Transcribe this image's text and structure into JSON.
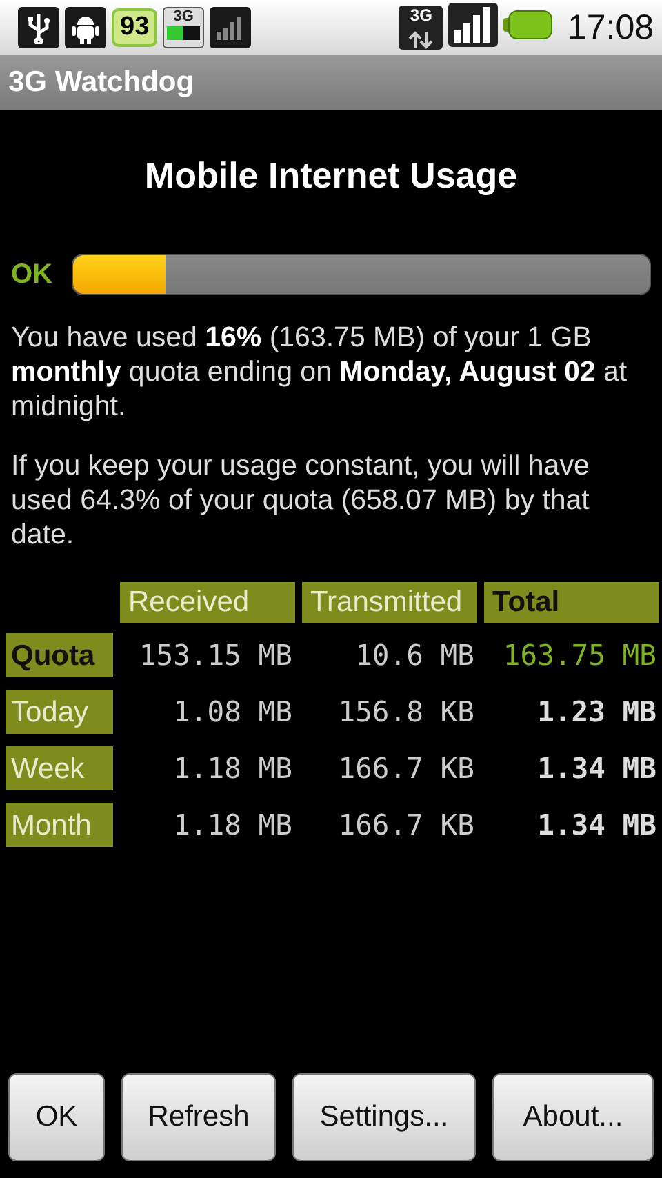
{
  "status_bar": {
    "battery_badge": "93",
    "sim_label": "3G",
    "network_label": "3G",
    "time": "17:08"
  },
  "window": {
    "title": "3G Watchdog"
  },
  "heading": "Mobile Internet Usage",
  "usage": {
    "status": "OK",
    "level": 0.16
  },
  "paragraphs": [
    "You have used **16%** (163.75 MB) of your 1 GB **monthly** quota ending on **Monday, August 02** at midnight.",
    "If you keep your usage constant, you will have used 64.3% of your quota (658.07 MB) by that date."
  ],
  "table": {
    "columns": [
      {
        "label": "Received",
        "bold": false
      },
      {
        "label": "Transmitted",
        "bold": false
      },
      {
        "label": "Total",
        "bold": true
      }
    ],
    "rows": [
      {
        "label": "Quota",
        "bold": true,
        "cells": [
          "153.15 MB",
          "10.6 MB",
          "163.75 MB"
        ]
      },
      {
        "label": "Today",
        "bold": false,
        "cells": [
          "1.08 MB",
          "156.8 KB",
          "1.23 MB"
        ]
      },
      {
        "label": "Week",
        "bold": false,
        "cells": [
          "1.18 MB",
          "166.7 KB",
          "1.34 MB"
        ]
      },
      {
        "label": "Month",
        "bold": false,
        "cells": [
          "1.18 MB",
          "166.7 KB",
          "1.34 MB"
        ]
      }
    ]
  },
  "buttons": [
    "OK",
    "Refresh",
    "Settings...",
    "About..."
  ]
}
